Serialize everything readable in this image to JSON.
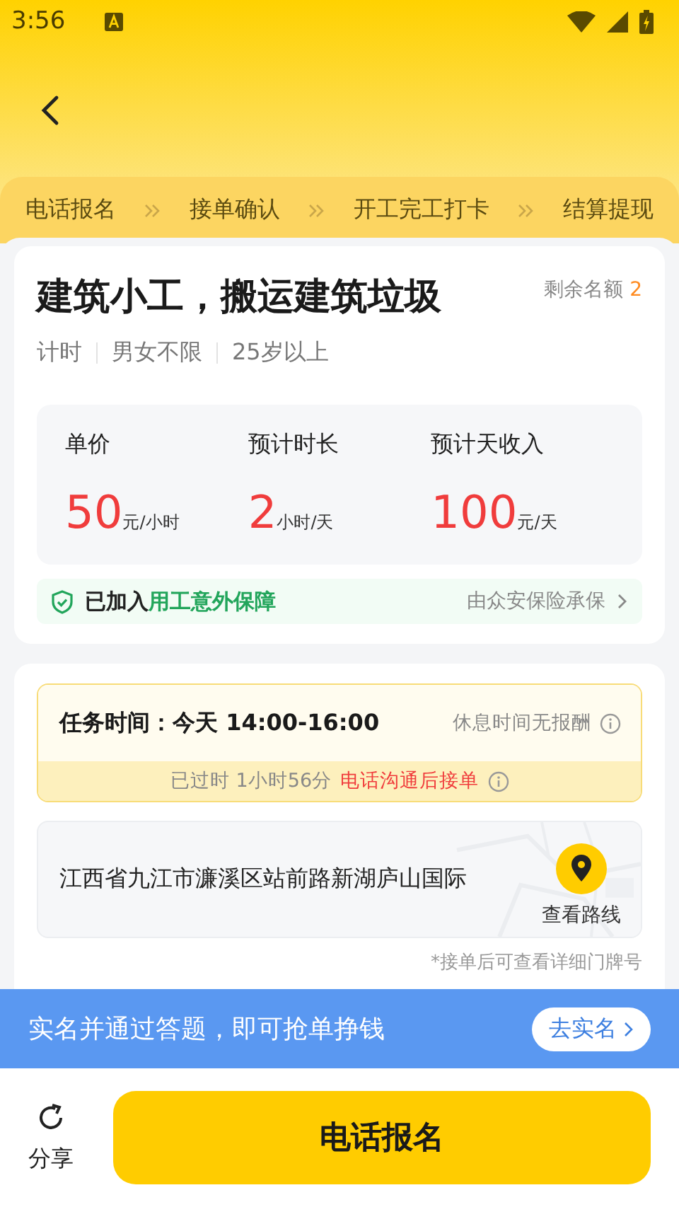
{
  "status_bar": {
    "time": "3:56"
  },
  "steps": [
    "电话报名",
    "接单确认",
    "开工完工打卡",
    "结算提现"
  ],
  "job": {
    "title": "建筑小工，搬运建筑垃圾",
    "quota_label": "剩余名额",
    "quota": "2",
    "tags": [
      "计时",
      "男女不限",
      "25岁以上"
    ]
  },
  "pay": [
    {
      "label": "单价",
      "amount": "50",
      "unit": "元/小时"
    },
    {
      "label": "预计时长",
      "amount": "2",
      "unit": "小时/天"
    },
    {
      "label": "预计天收入",
      "amount": "100",
      "unit": "元/天"
    }
  ],
  "insurance": {
    "prefix": "已加入",
    "highlight": "用工意外保障",
    "provider": "由众安保险承保"
  },
  "schedule": {
    "label": "任务时间：今天 14:00-16:00",
    "rest_note": "休息时间无报酬",
    "elapsed": "已过时 1小时56分",
    "action": "电话沟通后接单"
  },
  "address": {
    "text": "江西省九江市濂溪区站前路新湖庐山国际",
    "route_label": "查看路线",
    "note": "*接单后可查看详细门牌号"
  },
  "banner": {
    "text": "实名并通过答题，即可抢单挣钱",
    "button": "去实名"
  },
  "bottom": {
    "share": "分享",
    "cta": "电话报名"
  }
}
